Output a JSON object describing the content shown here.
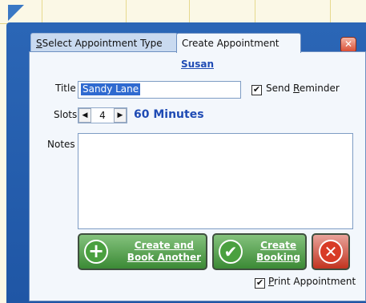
{
  "tabs": {
    "select_label": "Select Appointment Type",
    "create_label": "Create Appointment"
  },
  "customer_name": "Susan",
  "title_field": {
    "label": "Title",
    "value": "Sandy Lane"
  },
  "send_reminder": {
    "label_pre": "Send ",
    "label_ul": "R",
    "label_post": "eminder",
    "checked": true
  },
  "slots": {
    "label": "Slots",
    "value": "4",
    "duration": "60 Minutes"
  },
  "notes": {
    "label": "Notes",
    "value": ""
  },
  "buttons": {
    "create_and_book_line1": "Create and",
    "create_and_book_line2": "Book Another",
    "create_booking_line1": "Create",
    "create_booking_line2": "Booking"
  },
  "print_appointment": {
    "label_ul": "P",
    "label_post": "rint Appointment",
    "checked": true
  },
  "icons": {
    "close": "close-icon",
    "add": "plus-icon",
    "confirm": "check-icon",
    "cancel": "x-icon",
    "left_arrow": "left-arrow-icon",
    "right_arrow": "right-arrow-icon"
  },
  "colors": {
    "popup_frame": "#2b66b6",
    "accent_text": "#1f4bb4",
    "green_button": "#3b8a35",
    "red_button": "#c2331f"
  }
}
